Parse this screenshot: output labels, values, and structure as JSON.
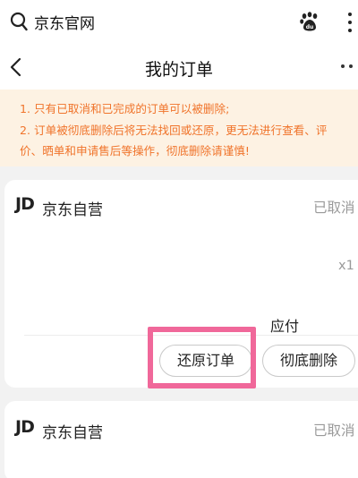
{
  "browser": {
    "site_title": "京东官网"
  },
  "nav": {
    "title": "我的订单"
  },
  "notice": {
    "lines": [
      "1. 只有已取消和已完成的订单可以被删除;",
      "2. 订单被彻底删除后将无法找回或还原，更无法进行查看、评",
      "价、晒单和申请售后等操作，彻底删除请谨慎!"
    ]
  },
  "orders": [
    {
      "logo": "JD",
      "shop": "京东自营",
      "status": "已取消",
      "quantity": "x1",
      "payable_label": "应付",
      "actions": {
        "restore": "还原订单",
        "delete": "彻底删除"
      }
    },
    {
      "logo": "JD",
      "shop": "京东自营",
      "status": "已取消"
    }
  ],
  "colors": {
    "notice_text": "#f0742b",
    "notice_bg": "#fdf2e3",
    "highlight": "#f0689a"
  }
}
